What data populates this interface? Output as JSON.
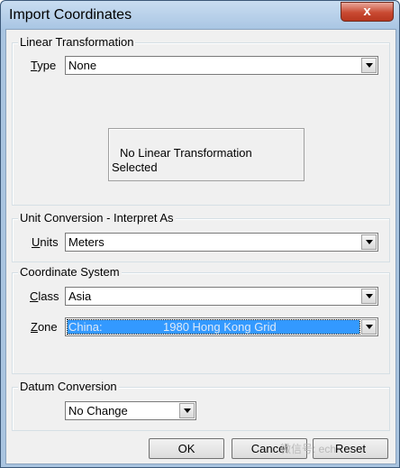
{
  "window": {
    "title": "Import Coordinates",
    "close_glyph": "x"
  },
  "linear_transformation": {
    "group_label": "Linear Transformation",
    "type_label_accel": "T",
    "type_label_rest": "ype",
    "type_value": "None",
    "info_line1": "No Linear Transformation",
    "info_line2": "Selected"
  },
  "unit_conversion": {
    "group_label": "Unit Conversion - Interpret As",
    "units_label_accel": "U",
    "units_label_rest": "nits",
    "units_value": "Meters"
  },
  "coordinate_system": {
    "group_label": "Coordinate System",
    "class_label_accel": "C",
    "class_label_rest": "lass",
    "class_value": "Asia",
    "zone_label_accel": "Z",
    "zone_label_rest": "one",
    "zone_value_part1": "China:",
    "zone_value_part2": "1980 Hong Kong Grid"
  },
  "datum_conversion": {
    "group_label": "Datum Conversion",
    "value": "No Change"
  },
  "buttons": {
    "ok": "OK",
    "cancel": "Cancel",
    "reset": "Reset"
  },
  "watermark": "微信号:          ech",
  "colors": {
    "selection": "#3399ff",
    "window_frame": "#a9c4e0",
    "close_button": "#c94a32"
  }
}
